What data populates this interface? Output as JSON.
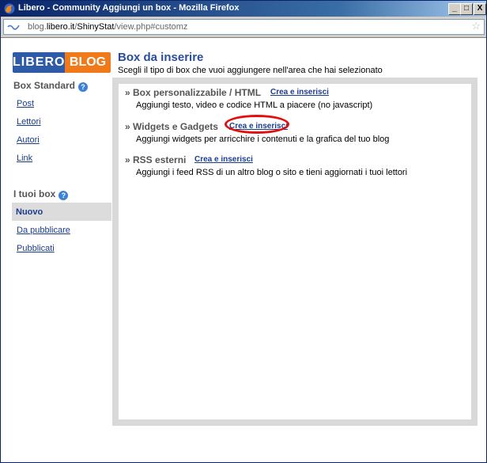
{
  "window": {
    "title": "Libero - Community Aggiungi un box - Mozilla Firefox",
    "controls": {
      "minimize": "_",
      "maximize": "□",
      "close": "X"
    }
  },
  "urlbar": {
    "prefix": "blog.",
    "domain": "libero.it",
    "path1": "/",
    "path_bold": "ShinyStat",
    "path2": "/view.php#customz",
    "bookmark_glyph": "☆"
  },
  "logo": {
    "part1": "LIBERO",
    "part2": "BLOG"
  },
  "sidebar": {
    "heading1": "Box Standard",
    "items1": [
      "Post",
      "Lettori",
      "Autori",
      "Link"
    ],
    "heading2": "I tuoi box",
    "active": "Nuovo",
    "items2": [
      "Da pubblicare",
      "Pubblicati"
    ],
    "help_glyph": "?"
  },
  "main": {
    "title": "Box da inserire",
    "subtitle": "Scegli il tipo di box che vuoi aggiungere nell'area che hai selezionato",
    "sections": [
      {
        "title": "» Box personalizzabile / HTML",
        "link": "Crea e inserisci",
        "desc": "Aggiungi testo, video e codice HTML a piacere (no javascript)"
      },
      {
        "title": "» Widgets e Gadgets",
        "link": "Crea e inserisci",
        "desc": "Aggiungi widgets per arricchire i contenuti e la grafica del tuo blog"
      },
      {
        "title": "» RSS esterni",
        "link": "Crea e inserisci",
        "desc": "Aggiungi i feed RSS di un altro blog o sito e tieni aggiornati i tuoi lettori"
      }
    ]
  },
  "colors": {
    "highlight_ring": "#e10f0f",
    "link": "#1a3c8e",
    "title": "#2a4d9b"
  }
}
